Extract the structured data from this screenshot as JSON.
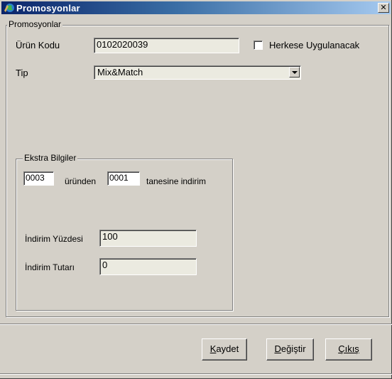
{
  "window": {
    "title": "Promosyonlar",
    "close_glyph": "✕"
  },
  "group_main": {
    "legend": "Promosyonlar"
  },
  "urun_kodu": {
    "label": "Ürün Kodu",
    "value": "0102020039"
  },
  "herkese": {
    "label": "Herkese Uygulanacak",
    "checked": false
  },
  "tip": {
    "label": "Tip",
    "value": "Mix&Match"
  },
  "group_ekstra": {
    "legend": "Ekstra Bilgiler"
  },
  "ekstra": {
    "qty1": "0003",
    "text1": "üründen",
    "qty2": "0001",
    "text2": "tanesine indirim"
  },
  "indirim_yuzdesi": {
    "label": "İndirim Yüzdesi",
    "value": "100"
  },
  "indirim_tutari": {
    "label": "İndirim Tutarı",
    "value": "0"
  },
  "buttons": {
    "kaydet": {
      "accel": "K",
      "rest": "aydet"
    },
    "degistir": {
      "accel": "D",
      "rest": "eğiştir"
    },
    "cikis": {
      "accel": "Ç",
      "pre": "",
      "mid": "ı",
      "accel2": "k",
      "rest": "ış",
      "full": "Çıkış"
    }
  }
}
